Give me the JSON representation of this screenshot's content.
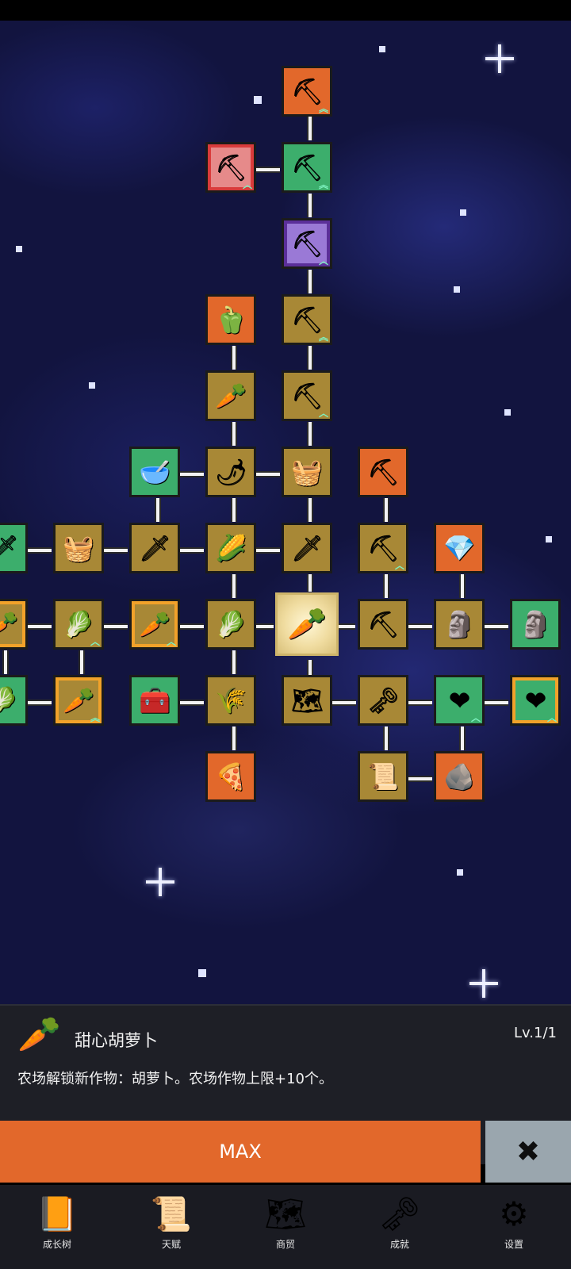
{
  "detail": {
    "icon": "carrot-icon",
    "title": "甜心胡萝卜",
    "level": "Lv.1/1",
    "description": "农场解锁新作物：胡萝卜。农场作物上限+10个。"
  },
  "actions": {
    "max_label": "MAX",
    "close_icon": "close-icon"
  },
  "bottom_nav": [
    {
      "icon": "book-icon",
      "label": "成长树"
    },
    {
      "icon": "scroll-icon",
      "label": "天赋"
    },
    {
      "icon": "map-icon",
      "label": "商贸"
    },
    {
      "icon": "key-icon",
      "label": "成就"
    },
    {
      "icon": "gear-icon",
      "label": "设置"
    }
  ],
  "tree": {
    "selected_node": "sweet-carrot",
    "nodes": [
      {
        "id": "shovel-top",
        "icon": "shovel-icon",
        "color": "orange"
      },
      {
        "id": "shovel-red",
        "icon": "shovel-icon",
        "color": "pink"
      },
      {
        "id": "shovel-green",
        "icon": "shovel-icon",
        "color": "green"
      },
      {
        "id": "shovel-purple",
        "icon": "shovel-icon",
        "color": "violet"
      },
      {
        "id": "pepper",
        "icon": "pepper-icon",
        "color": "orange"
      },
      {
        "id": "shovel-a",
        "icon": "shovel-icon",
        "color": "tan"
      },
      {
        "id": "radish",
        "icon": "radish-icon",
        "color": "tan"
      },
      {
        "id": "shovel-b",
        "icon": "shovel-icon",
        "color": "tan"
      },
      {
        "id": "bowl",
        "icon": "bowl-icon",
        "color": "green"
      },
      {
        "id": "chili",
        "icon": "chili-icon",
        "color": "tan"
      },
      {
        "id": "chest-grid",
        "icon": "crate-icon",
        "color": "tan"
      },
      {
        "id": "pickaxe-gold",
        "icon": "pickaxe-icon",
        "color": "orange"
      },
      {
        "id": "sword-edge",
        "icon": "sword-icon",
        "color": "green"
      },
      {
        "id": "crate",
        "icon": "crate-icon",
        "color": "tan"
      },
      {
        "id": "sword",
        "icon": "sword-icon",
        "color": "tan"
      },
      {
        "id": "corn",
        "icon": "corn-icon",
        "color": "tan"
      },
      {
        "id": "dagger",
        "icon": "dagger-icon",
        "color": "tan"
      },
      {
        "id": "pickaxe",
        "icon": "pickaxe-icon",
        "color": "tan"
      },
      {
        "id": "crystal",
        "icon": "crystal-icon",
        "color": "orange"
      },
      {
        "id": "carrot-edge",
        "icon": "carrot-icon",
        "color": "tan-gold"
      },
      {
        "id": "cabbage",
        "icon": "cabbage-icon",
        "color": "tan"
      },
      {
        "id": "carrot-2",
        "icon": "carrot-icon",
        "color": "tan-gold"
      },
      {
        "id": "cabbage-2",
        "icon": "cabbage-icon",
        "color": "tan"
      },
      {
        "id": "sweet-carrot",
        "icon": "carrot-icon",
        "color": "selected"
      },
      {
        "id": "pickaxe-2",
        "icon": "pickaxe-icon",
        "color": "tan"
      },
      {
        "id": "statue",
        "icon": "statue-icon",
        "color": "tan"
      },
      {
        "id": "statue-2",
        "icon": "statue-icon",
        "color": "green"
      },
      {
        "id": "cabbage-edge",
        "icon": "cabbage-icon",
        "color": "green"
      },
      {
        "id": "carrot-3",
        "icon": "carrot-icon",
        "color": "tan-gold"
      },
      {
        "id": "treasure",
        "icon": "treasure-chest-icon",
        "color": "green"
      },
      {
        "id": "wheat",
        "icon": "wheat-icon",
        "color": "tan"
      },
      {
        "id": "map",
        "icon": "map-icon",
        "color": "tan"
      },
      {
        "id": "key",
        "icon": "key-icon",
        "color": "tan"
      },
      {
        "id": "heart",
        "icon": "heart-icon",
        "color": "green"
      },
      {
        "id": "heart-2",
        "icon": "heart-icon",
        "color": "green-gold"
      },
      {
        "id": "pizza",
        "icon": "pizza-icon",
        "color": "orange"
      },
      {
        "id": "scroll",
        "icon": "scroll-icon",
        "color": "tan"
      },
      {
        "id": "stone",
        "icon": "stone-icon",
        "color": "orange"
      }
    ]
  }
}
